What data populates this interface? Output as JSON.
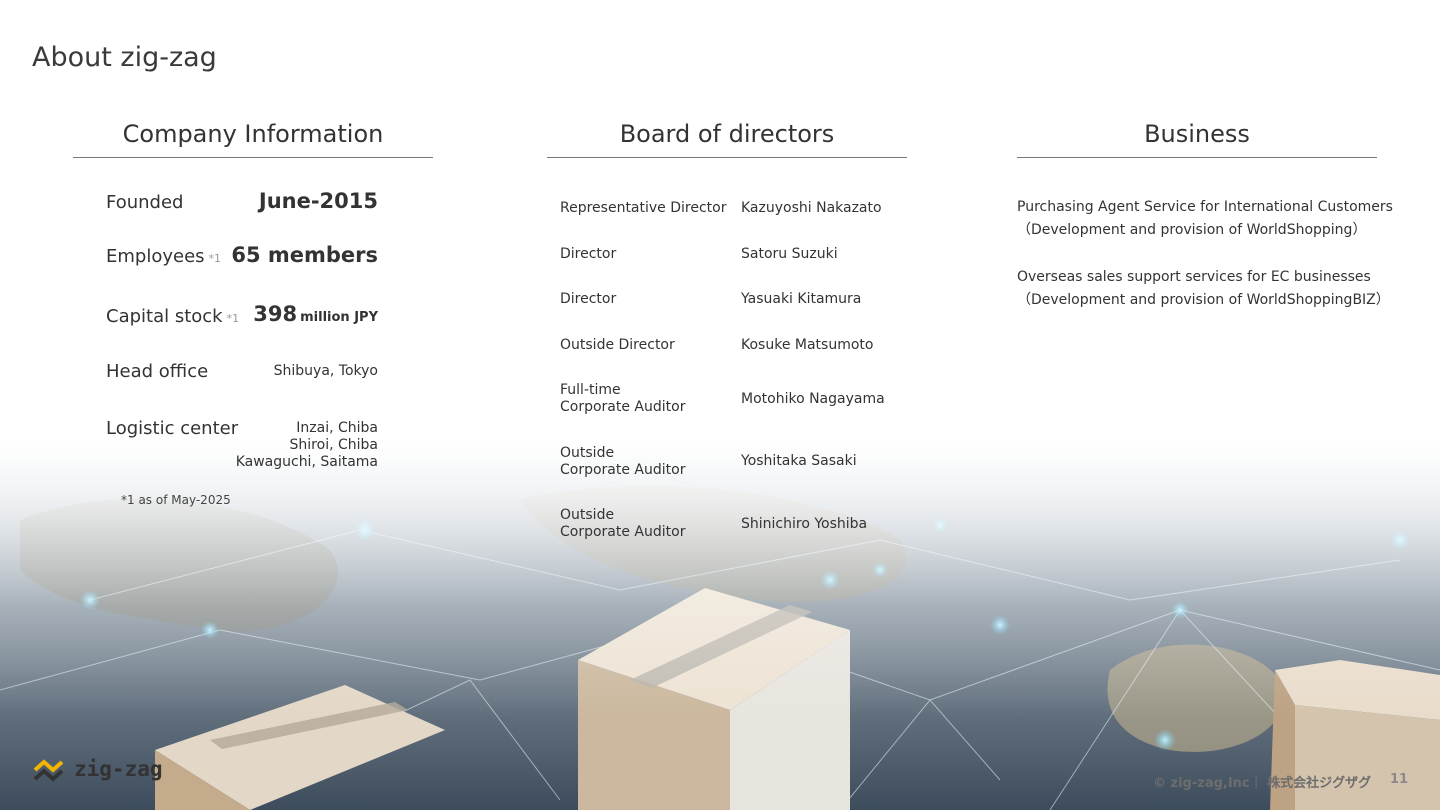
{
  "page": {
    "title": "About zig-zag",
    "page_number": "11"
  },
  "company": {
    "heading": "Company Information",
    "rows": [
      {
        "label": "Founded",
        "note": "",
        "value": "June-2015",
        "unit": ""
      },
      {
        "label": "Employees",
        "note": "*1",
        "value": "65 members",
        "unit": ""
      },
      {
        "label": "Capital stock",
        "note": "*1",
        "value": "398",
        "unit": "million JPY"
      },
      {
        "label": "Head office",
        "note": "",
        "value": "Shibuya, Tokyo",
        "unit": ""
      },
      {
        "label": "Logistic center",
        "note": "",
        "value_lines": [
          "Inzai, Chiba",
          "Shiroi, Chiba",
          "Kawaguchi, Saitama"
        ]
      }
    ],
    "footnote": "*1 as of May-2025"
  },
  "board": {
    "heading": "Board of directors",
    "members": [
      {
        "role_lines": [
          "Representative Director"
        ],
        "name": "Kazuyoshi Nakazato"
      },
      {
        "role_lines": [
          "Director"
        ],
        "name": "Satoru Suzuki"
      },
      {
        "role_lines": [
          "Director"
        ],
        "name": "Yasuaki Kitamura"
      },
      {
        "role_lines": [
          "Outside Director"
        ],
        "name": "Kosuke Matsumoto"
      },
      {
        "role_lines": [
          "Full-time",
          "Corporate Auditor"
        ],
        "name": "Motohiko Nagayama"
      },
      {
        "role_lines": [
          "Outside",
          "Corporate Auditor"
        ],
        "name": "Yoshitaka Sasaki"
      },
      {
        "role_lines": [
          "Outside",
          "Corporate Auditor"
        ],
        "name": "Shinichiro Yoshiba"
      }
    ]
  },
  "business": {
    "heading": "Business",
    "items": [
      {
        "line1": "Purchasing Agent Service for International Customers",
        "line2": "（Development and provision of WorldShopping）"
      },
      {
        "line1": "Overseas sales support services for EC businesses",
        "line2": "（Development and provision of WorldShoppingBIZ）"
      }
    ]
  },
  "footer": {
    "logo_text": "zig-zag",
    "logo_color": "#f2b400",
    "copyright": "© zig-zag,Inc｜ 株式会社ジグザグ"
  }
}
